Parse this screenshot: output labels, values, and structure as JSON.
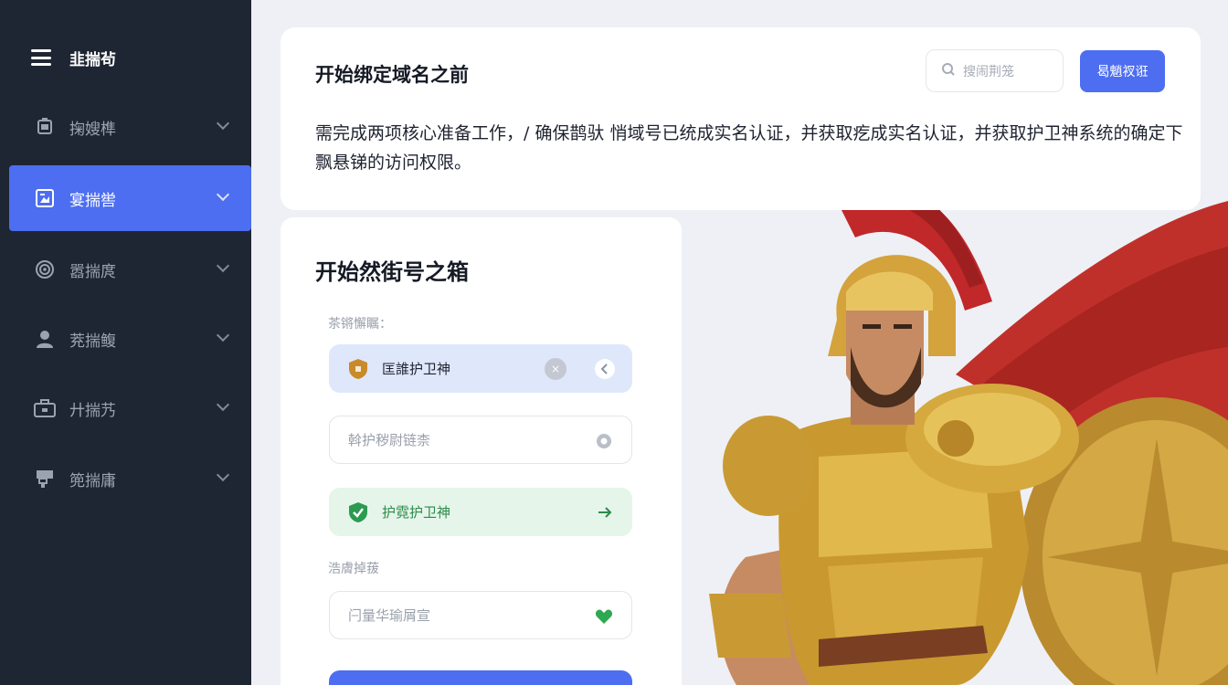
{
  "sidebar": {
    "brand": "韭揣茍",
    "items": [
      {
        "label": "掬嫂榫",
        "icon": "monitor-icon"
      },
      {
        "label": "宴揣喾",
        "icon": "image-icon"
      },
      {
        "label": "嚣揣庹",
        "icon": "target-icon"
      },
      {
        "label": "茺揣鳆",
        "icon": "user-icon"
      },
      {
        "label": "廾揣艿",
        "icon": "briefcase-icon"
      },
      {
        "label": "篼揣庸",
        "icon": "archive-icon"
      }
    ]
  },
  "header": {
    "title": "开始绑定域名之前",
    "search_placeholder": "搜闹荆笼",
    "action_label": "曷魈衩诳",
    "description": "需完成两项核心准备工作，/ 确保鹊驮 悄域号已统成实名认证，并获取疙成实名认证，并获取护卫神系统的确定下　飘悬锑的访问权限。"
  },
  "form": {
    "title": "开始然街号之箱",
    "section1_label": "茶锵懈瞩：",
    "selected_field": "匡誰护卫神",
    "input_placeholder": "斡护秽尉链柰",
    "green_field": "护霓护卫神",
    "section2_label": "浩膚掉菝",
    "input2_placeholder": "闩量华瑜屑宣"
  },
  "colors": {
    "sidebar_bg": "#1f2633",
    "accent": "#4d6ef0",
    "success": "#2c8c4a",
    "background": "#eef0f5"
  }
}
